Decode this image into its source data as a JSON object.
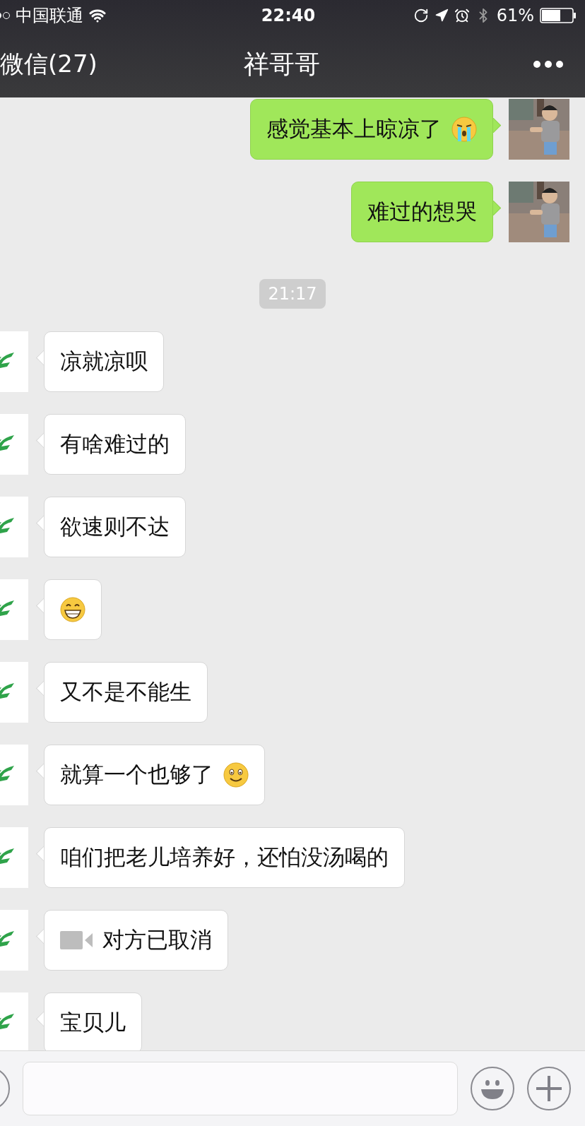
{
  "status_bar": {
    "carrier": "中国联通",
    "time": "22:40",
    "battery": "61%"
  },
  "nav": {
    "back": "微信(27)",
    "title": "祥哥哥"
  },
  "messages": [
    {
      "kind": "text",
      "outgoing": true,
      "parts": [
        {
          "kind": "text",
          "text": "感觉基本上晾凉了"
        },
        {
          "kind": "crying"
        }
      ]
    },
    {
      "kind": "text",
      "outgoing": true,
      "parts": [
        {
          "kind": "text",
          "text": "难过的想哭"
        }
      ]
    },
    {
      "kind": "time",
      "text": "21:17"
    },
    {
      "kind": "text",
      "outgoing": false,
      "parts": [
        {
          "kind": "text",
          "text": "凉就凉呗"
        }
      ]
    },
    {
      "kind": "text",
      "outgoing": false,
      "parts": [
        {
          "kind": "text",
          "text": "有啥难过的"
        }
      ]
    },
    {
      "kind": "text",
      "outgoing": false,
      "parts": [
        {
          "kind": "text",
          "text": "欲速则不达"
        }
      ]
    },
    {
      "kind": "text",
      "outgoing": false,
      "parts": [
        {
          "kind": "grin"
        }
      ]
    },
    {
      "kind": "text",
      "outgoing": false,
      "parts": [
        {
          "kind": "text",
          "text": "又不是不能生"
        }
      ]
    },
    {
      "kind": "text",
      "outgoing": false,
      "parts": [
        {
          "kind": "text",
          "text": "就算一个也够了"
        },
        {
          "kind": "smile"
        }
      ]
    },
    {
      "kind": "text",
      "outgoing": false,
      "parts": [
        {
          "kind": "text",
          "text": "咱们把老儿培养好，还怕没汤喝的"
        }
      ]
    },
    {
      "kind": "video_call",
      "outgoing": false,
      "parts": [
        {
          "kind": "text",
          "text": "对方已取消"
        }
      ]
    },
    {
      "kind": "text",
      "outgoing": false,
      "parts": [
        {
          "kind": "text",
          "text": "宝贝儿"
        }
      ]
    }
  ]
}
